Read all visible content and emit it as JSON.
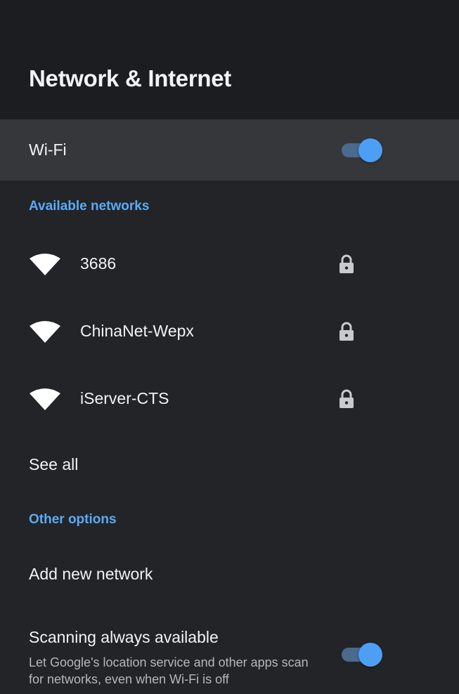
{
  "header": {
    "title": "Network & Internet"
  },
  "wifi": {
    "label": "Wi-Fi",
    "enabled": true,
    "accent_color": "#4c9ff5"
  },
  "sections": {
    "available_networks": "Available networks",
    "other_options": "Other options"
  },
  "networks": [
    {
      "name": "3686",
      "icon": "wifi-icon",
      "secured": true,
      "secure_icon": "lock-icon"
    },
    {
      "name": "ChinaNet-Wepx",
      "icon": "wifi-icon",
      "secured": true,
      "secure_icon": "lock-icon"
    },
    {
      "name": "iServer-CTS",
      "icon": "wifi-icon",
      "secured": true,
      "secure_icon": "lock-icon"
    }
  ],
  "see_all": "See all",
  "add_network": "Add new network",
  "scanning": {
    "title": "Scanning always available",
    "description": "Let Google's location service and other apps scan for networks, even when Wi-Fi is off",
    "enabled": true
  }
}
